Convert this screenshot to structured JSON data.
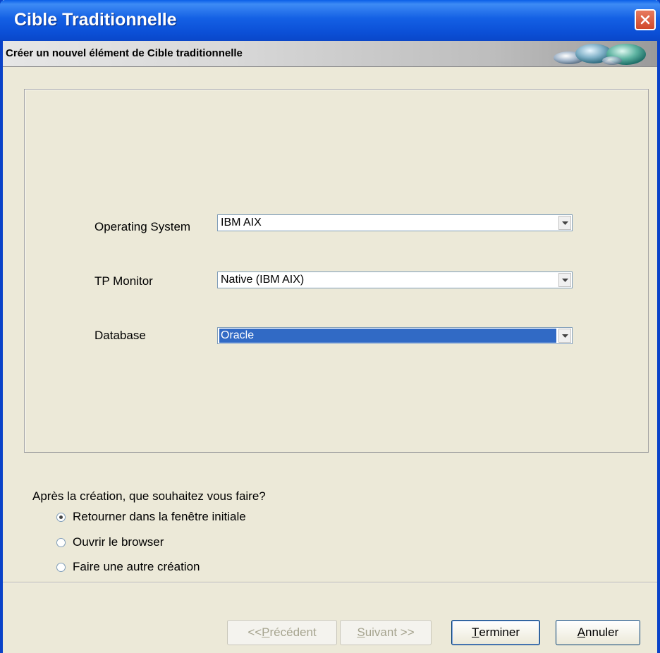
{
  "window": {
    "title": "Cible Traditionnelle",
    "close_icon": "close-icon"
  },
  "header": {
    "text": "Créer un nouvel élément de Cible traditionnelle"
  },
  "form": {
    "operating_system": {
      "label": "Operating System",
      "value": "IBM AIX"
    },
    "tp_monitor": {
      "label": "TP Monitor",
      "value": "Native (IBM AIX)"
    },
    "database": {
      "label": "Database",
      "value": "Oracle"
    }
  },
  "after_creation": {
    "question": "Après la création, que souhaitez vous faire?",
    "options": [
      {
        "label": "Retourner dans la fenêtre initiale",
        "checked": true
      },
      {
        "label": "Ouvrir le browser",
        "checked": false
      },
      {
        "label": "Faire une autre création",
        "checked": false
      }
    ]
  },
  "buttons": {
    "previous": {
      "mnemonic": "<< ",
      "underlined": "P",
      "rest": "récédent",
      "enabled": false
    },
    "next": {
      "mnemonic": "",
      "underlined": "S",
      "rest": "uivant >>",
      "enabled": false
    },
    "finish": {
      "mnemonic": "",
      "underlined": "T",
      "rest": "erminer",
      "enabled": true
    },
    "cancel": {
      "mnemonic": "",
      "underlined": "A",
      "rest": "nnuler",
      "enabled": true
    }
  },
  "colors": {
    "titlebar": "#0a4fd6",
    "selection": "#316ac5",
    "background": "#ece9d8"
  }
}
